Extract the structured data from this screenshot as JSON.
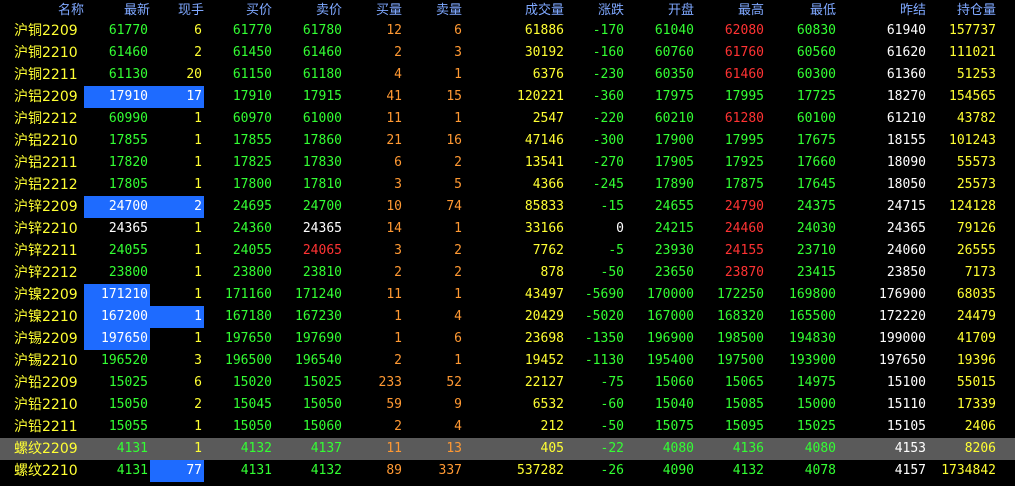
{
  "columns": [
    "名称",
    "最新",
    "现手",
    "买价",
    "卖价",
    "买量",
    "卖量",
    "成交量",
    "涨跌",
    "开盘",
    "最高",
    "最低",
    "昨结",
    "持仓量"
  ],
  "rows": [
    {
      "cells": [
        "沪铜2209",
        "61770",
        "6",
        "61770",
        "61780",
        "12",
        "6",
        "61886",
        "-170",
        "61040",
        "62080",
        "60830",
        "61940",
        "157737"
      ],
      "hl": []
    },
    {
      "cells": [
        "沪铜2210",
        "61460",
        "2",
        "61450",
        "61460",
        "2",
        "3",
        "30192",
        "-160",
        "60760",
        "61760",
        "60560",
        "61620",
        "111021"
      ],
      "hl": []
    },
    {
      "cells": [
        "沪铜2211",
        "61130",
        "20",
        "61150",
        "61180",
        "4",
        "1",
        "6376",
        "-230",
        "60350",
        "61460",
        "60300",
        "61360",
        "51253"
      ],
      "hl": []
    },
    {
      "cells": [
        "沪铝2209",
        "17910",
        "17",
        "17910",
        "17915",
        "41",
        "15",
        "120221",
        "-360",
        "17975",
        "17995",
        "17725",
        "18270",
        "154565"
      ],
      "hl": [
        1,
        2
      ]
    },
    {
      "cells": [
        "沪铜2212",
        "60990",
        "1",
        "60970",
        "61000",
        "11",
        "1",
        "2547",
        "-220",
        "60210",
        "61280",
        "60100",
        "61210",
        "43782"
      ],
      "hl": []
    },
    {
      "cells": [
        "沪铝2210",
        "17855",
        "1",
        "17855",
        "17860",
        "21",
        "16",
        "47146",
        "-300",
        "17900",
        "17995",
        "17675",
        "18155",
        "101243"
      ],
      "hl": []
    },
    {
      "cells": [
        "沪铝2211",
        "17820",
        "1",
        "17825",
        "17830",
        "6",
        "2",
        "13541",
        "-270",
        "17905",
        "17925",
        "17660",
        "18090",
        "55573"
      ],
      "hl": []
    },
    {
      "cells": [
        "沪铝2212",
        "17805",
        "1",
        "17800",
        "17810",
        "3",
        "5",
        "4366",
        "-245",
        "17890",
        "17875",
        "17645",
        "18050",
        "25573"
      ],
      "hl": []
    },
    {
      "cells": [
        "沪锌2209",
        "24700",
        "2",
        "24695",
        "24700",
        "10",
        "74",
        "85833",
        "-15",
        "24655",
        "24790",
        "24375",
        "24715",
        "124128"
      ],
      "hl": [
        1,
        2
      ]
    },
    {
      "cells": [
        "沪锌2210",
        "24365",
        "1",
        "24360",
        "24365",
        "14",
        "1",
        "33166",
        "0",
        "24215",
        "24460",
        "24030",
        "24365",
        "79126"
      ],
      "hl": []
    },
    {
      "cells": [
        "沪锌2211",
        "24055",
        "1",
        "24055",
        "24065",
        "3",
        "2",
        "7762",
        "-5",
        "23930",
        "24155",
        "23710",
        "24060",
        "26555"
      ],
      "hl": []
    },
    {
      "cells": [
        "沪锌2212",
        "23800",
        "1",
        "23800",
        "23810",
        "2",
        "2",
        "878",
        "-50",
        "23650",
        "23870",
        "23415",
        "23850",
        "7173"
      ],
      "hl": []
    },
    {
      "cells": [
        "沪镍2209",
        "171210",
        "1",
        "171160",
        "171240",
        "11",
        "1",
        "43497",
        "-5690",
        "170000",
        "172250",
        "169800",
        "176900",
        "68035"
      ],
      "hl": [
        1
      ]
    },
    {
      "cells": [
        "沪镍2210",
        "167200",
        "1",
        "167180",
        "167230",
        "1",
        "4",
        "20429",
        "-5020",
        "167000",
        "168320",
        "165500",
        "172220",
        "24479"
      ],
      "hl": [
        1,
        2
      ]
    },
    {
      "cells": [
        "沪锡2209",
        "197650",
        "1",
        "197650",
        "197690",
        "1",
        "6",
        "23698",
        "-1350",
        "196900",
        "198500",
        "194830",
        "199000",
        "41709"
      ],
      "hl": [
        1
      ]
    },
    {
      "cells": [
        "沪锡2210",
        "196520",
        "3",
        "196500",
        "196540",
        "2",
        "1",
        "19452",
        "-1130",
        "195400",
        "197500",
        "193900",
        "197650",
        "19396"
      ],
      "hl": []
    },
    {
      "cells": [
        "沪铅2209",
        "15025",
        "6",
        "15020",
        "15025",
        "233",
        "52",
        "22127",
        "-75",
        "15060",
        "15065",
        "14975",
        "15100",
        "55015"
      ],
      "hl": []
    },
    {
      "cells": [
        "沪铅2210",
        "15050",
        "2",
        "15045",
        "15050",
        "59",
        "9",
        "6532",
        "-60",
        "15040",
        "15085",
        "15000",
        "15110",
        "17339"
      ],
      "hl": []
    },
    {
      "cells": [
        "沪铅2211",
        "15055",
        "1",
        "15050",
        "15060",
        "2",
        "4",
        "212",
        "-50",
        "15075",
        "15095",
        "15025",
        "15105",
        "2406"
      ],
      "hl": []
    },
    {
      "cells": [
        "螺纹2209",
        "4131",
        "1",
        "4132",
        "4137",
        "11",
        "13",
        "405",
        "-22",
        "4080",
        "4136",
        "4080",
        "4153",
        "8206"
      ],
      "hl": [],
      "selected": true
    },
    {
      "cells": [
        "螺纹2210",
        "4131",
        "77",
        "4131",
        "4132",
        "89",
        "337",
        "537282",
        "-26",
        "4090",
        "4132",
        "4078",
        "4157",
        "1734842"
      ],
      "hl": [
        2
      ]
    }
  ],
  "colors": {
    "white": "#ffffff",
    "yellow": "#ffff33",
    "green": "#33ff33",
    "red": "#ff3333",
    "blue": "#8fb8ff",
    "orange": "#ff9933",
    "highlight": "#1e6bff",
    "header": "#7fa8ff"
  }
}
